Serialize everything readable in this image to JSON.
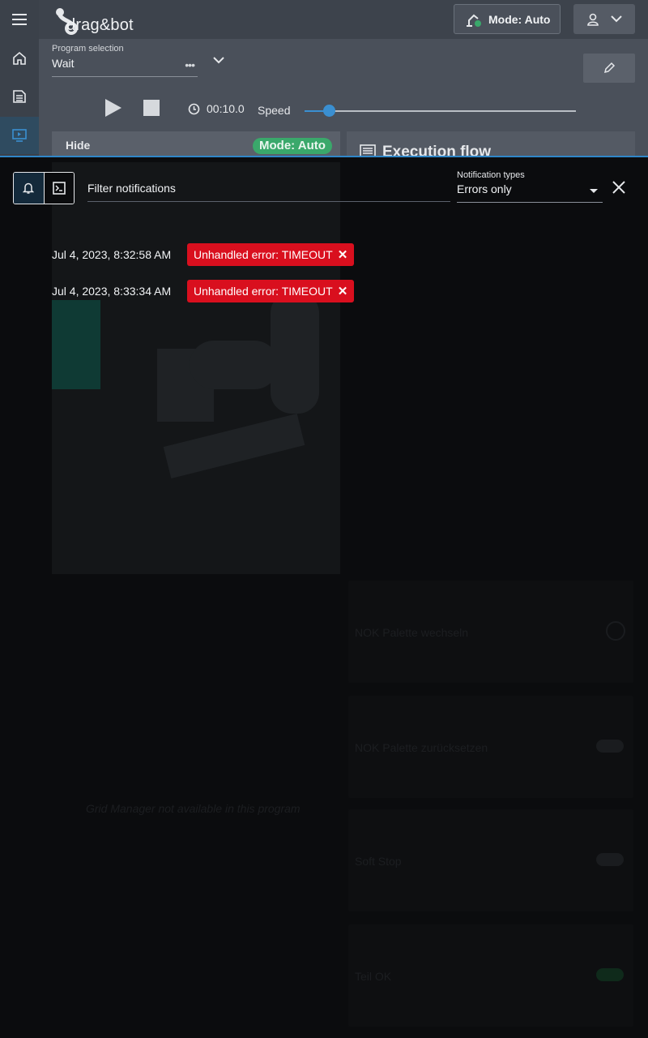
{
  "header": {
    "logo_text": "drag&bot",
    "mode_label": "Mode: Auto"
  },
  "program": {
    "label": "Program selection",
    "value": "Wait",
    "dots": "•••"
  },
  "transport": {
    "timer": "00:10.0",
    "speed_label": "Speed",
    "speed_fraction": 0.09
  },
  "panel": {
    "hide_label": "Hide",
    "mode_badge": "Mode: Auto",
    "exec_title": "Execution flow"
  },
  "background_ghost": {
    "grid_message": "Grid Manager not available in this program",
    "cards": [
      "NOK Palette wechseln",
      "NOK Palette zurücksetzen",
      "Soft Stop",
      "Teil OK"
    ]
  },
  "notifications": {
    "filter_label": "Filter notifications",
    "types_label": "Notification types",
    "types_value": "Errors only",
    "items": [
      {
        "time": "Jul 4, 2023, 8:32:58 AM",
        "message": "Unhandled error: TIMEOUT"
      },
      {
        "time": "Jul 4, 2023, 8:33:34 AM",
        "message": "Unhandled error: TIMEOUT"
      }
    ]
  },
  "colors": {
    "accent": "#2f86c8",
    "error": "#d90f1e",
    "success": "#3aa86b"
  }
}
